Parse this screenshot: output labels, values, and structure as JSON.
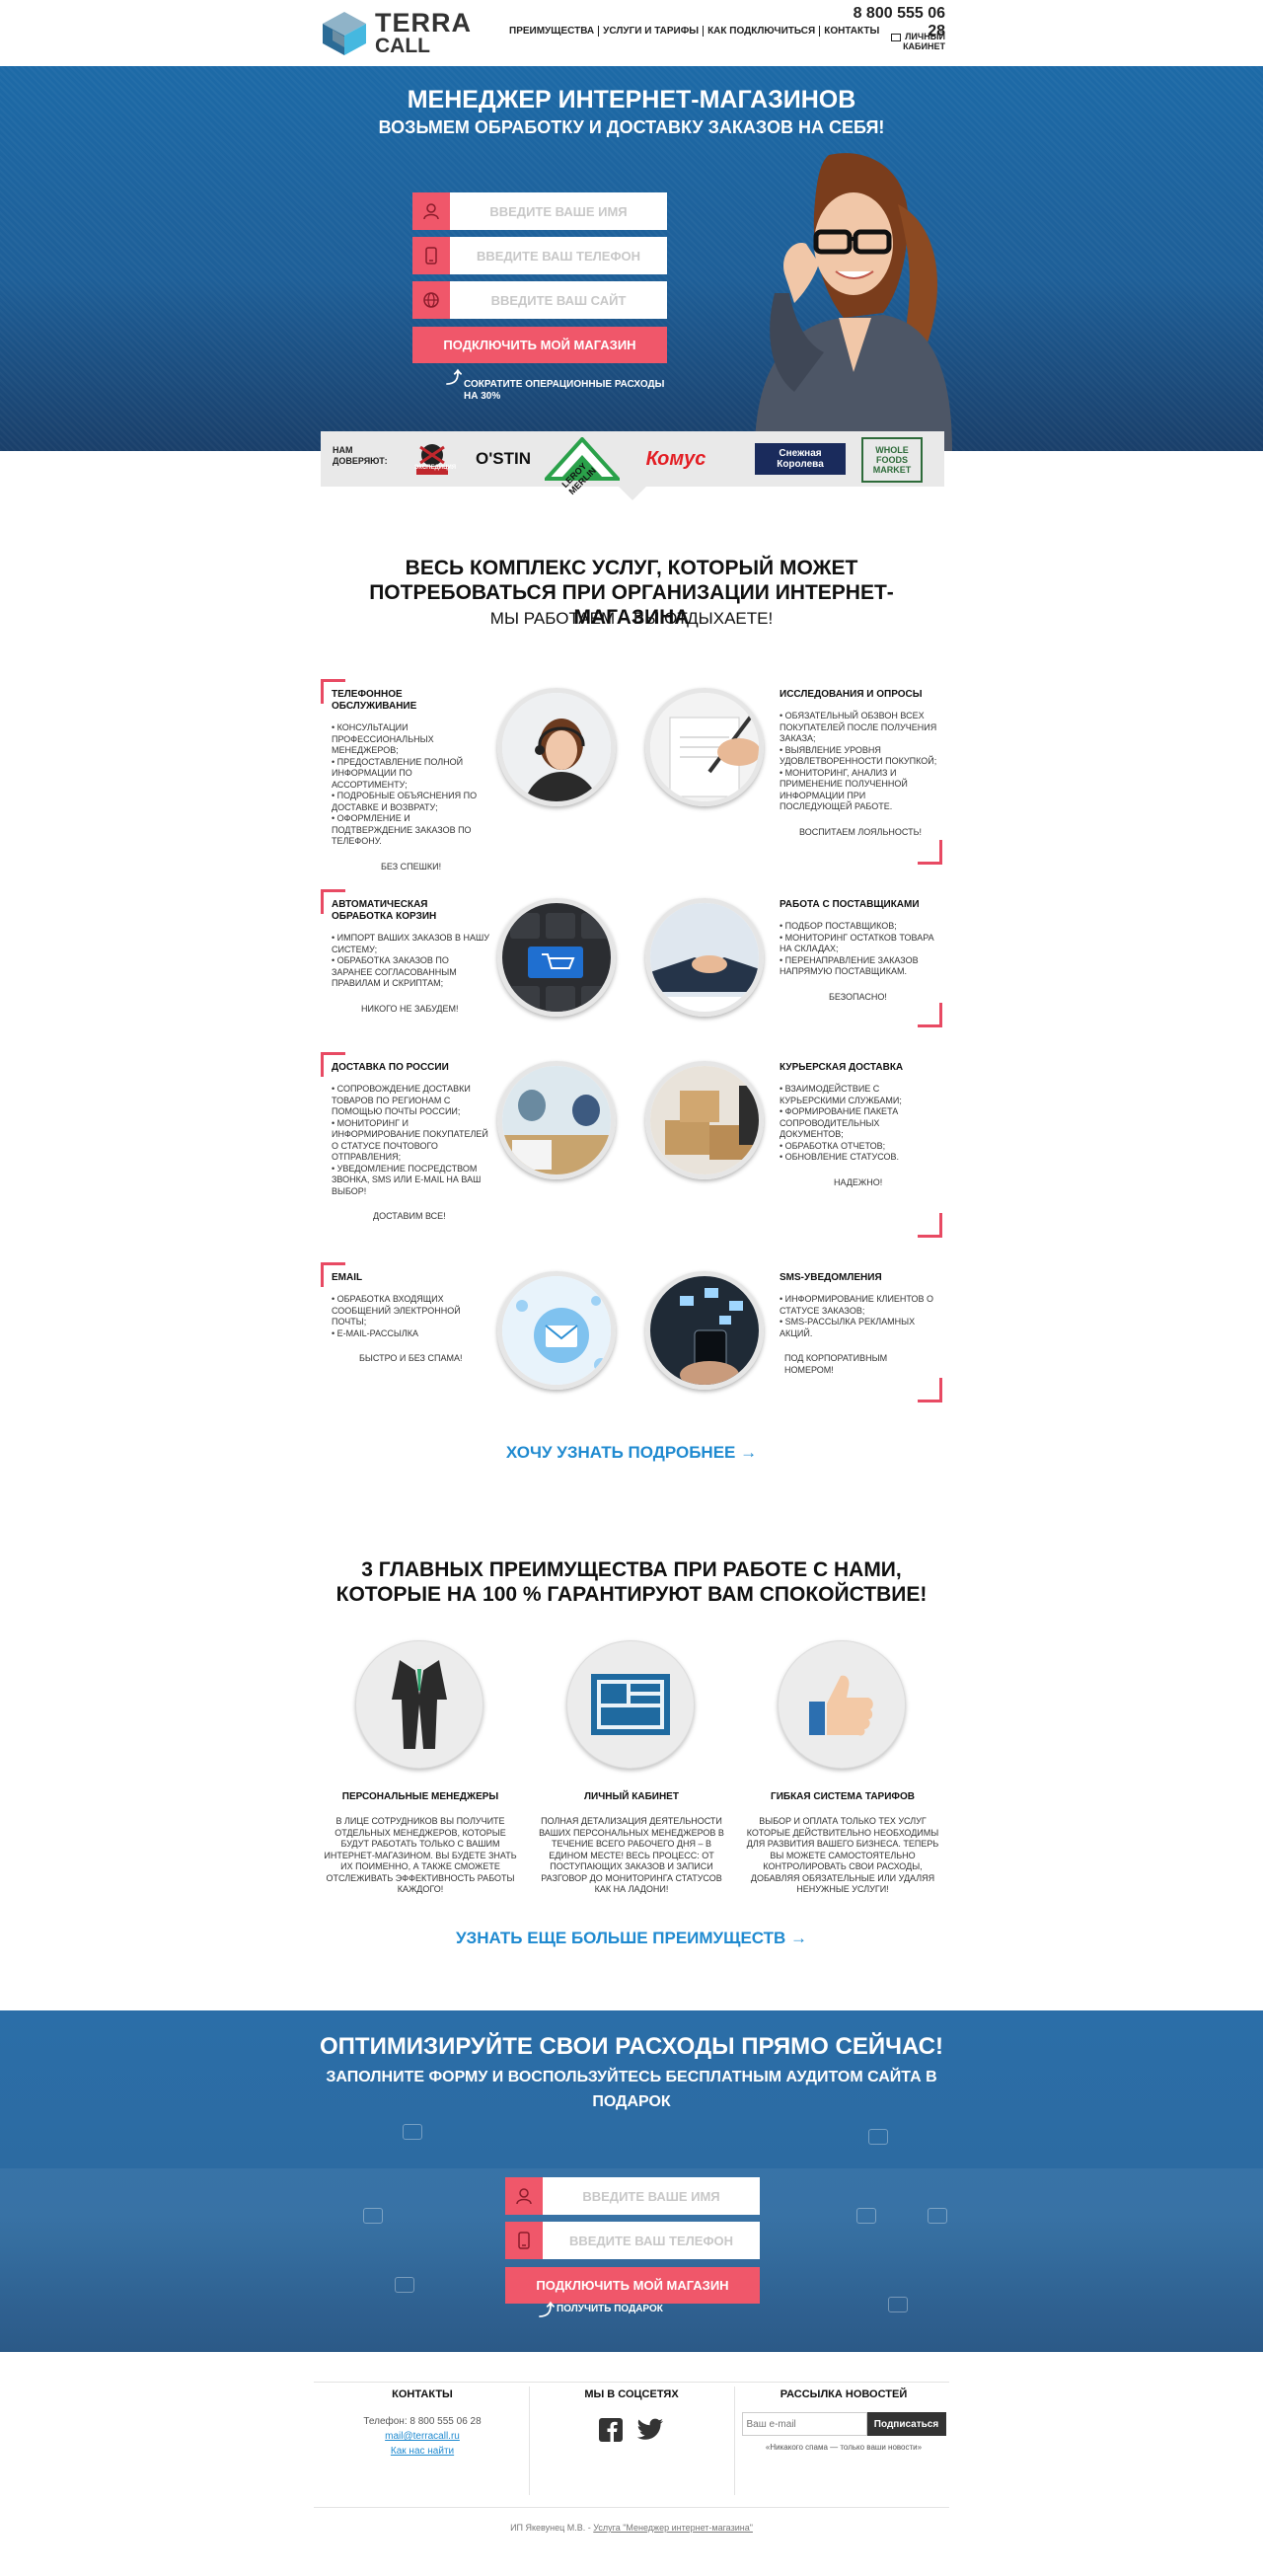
{
  "header": {
    "logo_text1": "TERRA",
    "logo_text2": "CALL",
    "nav": [
      "ПРЕИМУЩЕСТВА",
      "УСЛУГИ И ТАРИФЫ",
      "КАК ПОДКЛЮЧИТЬСЯ",
      "КОНТАКТЫ"
    ],
    "phone": "8 800 555 06 28",
    "cabinet": "ЛИЧНЫЙ КАБИНЕТ"
  },
  "hero": {
    "title": "МЕНЕДЖЕР ИНТЕРНЕТ-МАГАЗИНОВ",
    "subtitle": "ВОЗЬМЕМ ОБРАБОТКУ И ДОСТАВКУ ЗАКАЗОВ НА СЕБЯ!",
    "name_placeholder": "ВВЕДИТЕ ВАШЕ ИМЯ",
    "phone_placeholder": "ВВЕДИТЕ ВАШ ТЕЛЕФОН",
    "site_placeholder": "ВВЕДИТЕ ВАШ САЙТ",
    "submit": "ПОДКЛЮЧИТЬ МОЙ МАГАЗИН",
    "note": "СОКРАТИТЕ ОПЕРАЦИОННЫЕ РАСХОДЫ НА 30%"
  },
  "clients": {
    "label": "НАМ ДОВЕРЯЮТ:",
    "brands": [
      "ЭКСПЕДИЦИЯ",
      "O'STIN",
      "LEROY MERLIN",
      "Комус",
      "Снежная Королева",
      "WHOLE FOODS MARKET"
    ]
  },
  "services": {
    "title": "ВЕСЬ КОМПЛЕКС УСЛУГ, КОТОРЫЙ МОЖЕТ ПОТРЕБОВАТЬСЯ ПРИ ОРГАНИЗАЦИИ ИНТЕРНЕТ-МАГАЗИНА",
    "subtitle": "МЫ РАБОТАЕМ – ВЫ ОТДЫХАЕТЕ!",
    "items": [
      {
        "title": "ТЕЛЕФОННОЕ ОБСЛУЖИВАНИЕ",
        "body": "• КОНСУЛЬТАЦИИ ПРОФЕССИОНАЛЬНЫХ МЕНЕДЖЕРОВ;\n• ПРЕДОСТАВЛЕНИЕ ПОЛНОЙ ИНФОРМАЦИИ ПО АССОРТИМЕНТУ;\n• ПОДРОБНЫЕ ОБЪЯСНЕНИЯ ПО ДОСТАВКЕ И ВОЗВРАТУ;\n• ОФОРМЛЕНИЕ И ПОДТВЕРЖДЕНИЕ ЗАКАЗОВ ПО ТЕЛЕФОНУ.",
        "tag": "БЕЗ СПЕШКИ!"
      },
      {
        "title": "ИССЛЕДОВАНИЯ И ОПРОСЫ",
        "body": "• ОБЯЗАТЕЛЬНЫЙ ОБЗВОН ВСЕХ ПОКУПАТЕЛЕЙ ПОСЛЕ ПОЛУЧЕНИЯ ЗАКАЗА;\n• ВЫЯВЛЕНИЕ УРОВНЯ УДОВЛЕТВОРЕННОСТИ ПОКУПКОЙ;\n• МОНИТОРИНГ, АНАЛИЗ И ПРИМЕНЕНИЕ ПОЛУЧЕННОЙ ИНФОРМАЦИИ ПРИ ПОСЛЕДУЮЩЕЙ РАБОТЕ.",
        "tag": "ВОСПИТАЕМ ЛОЯЛЬНОСТЬ!"
      },
      {
        "title": "АВТОМАТИЧЕСКАЯ ОБРАБОТКА КОРЗИН",
        "body": "• ИМПОРТ ВАШИХ ЗАКАЗОВ В НАШУ СИСТЕМУ;\n• ОБРАБОТКА ЗАКАЗОВ ПО ЗАРАНЕЕ СОГЛАСОВАННЫМ ПРАВИЛАМ И СКРИПТАМ;",
        "tag": "НИКОГО НЕ ЗАБУДЕМ!"
      },
      {
        "title": "РАБОТА С ПОСТАВЩИКАМИ",
        "body": "• ПОДБОР ПОСТАВЩИКОВ;\n• МОНИТОРИНГ ОСТАТКОВ ТОВАРА НА СКЛАДАХ;\n• ПЕРЕНАПРАВЛЕНИЕ ЗАКАЗОВ НАПРЯМУЮ ПОСТАВЩИКАМ.",
        "tag": "БЕЗОПАСНО!"
      },
      {
        "title": "ДОСТАВКА ПО РОССИИ",
        "body": "• СОПРОВОЖДЕНИЕ ДОСТАВКИ ТОВАРОВ ПО РЕГИОНАМ С ПОМОЩЬЮ ПОЧТЫ РОССИИ;\n• МОНИТОРИНГ И ИНФОРМИРОВАНИЕ ПОКУПАТЕЛЕЙ О СТАТУСЕ ПОЧТОВОГО ОТПРАВЛЕНИЯ;\n• УВЕДОМЛЕНИЕ ПОСРЕДСТВОМ ЗВОНКА, SMS ИЛИ E-MAIL НА ВАШ ВЫБОР!",
        "tag": "ДОСТАВИМ ВСЕ!"
      },
      {
        "title": "КУРЬЕРСКАЯ ДОСТАВКА",
        "body": "• ВЗАИМОДЕЙСТВИЕ С КУРЬЕРСКИМИ СЛУЖБАМИ;\n• ФОРМИРОВАНИЕ ПАКЕТА СОПРОВОДИТЕЛЬНЫХ ДОКУМЕНТОВ;\n• ОБРАБОТКА ОТЧЕТОВ;\n• ОБНОВЛЕНИЕ СТАТУСОВ.",
        "tag": "НАДЕЖНО!"
      },
      {
        "title": "EMAIL",
        "body": "• ОБРАБОТКА ВХОДЯЩИХ СООБЩЕНИЙ ЭЛЕКТРОННОЙ ПОЧТЫ;\n• E-MAIL-РАССЫЛКА",
        "tag": "БЫСТРО И БЕЗ СПАМА!"
      },
      {
        "title": "SMS-УВЕДОМЛЕНИЯ",
        "body": "• ИНФОРМИРОВАНИЕ КЛИЕНТОВ О СТАТУСЕ ЗАКАЗОВ;\n• SMS-РАССЫЛКА РЕКЛАМНЫХ АКЦИЙ.",
        "tag": "ПОД КОРПОРАТИВНЫМ НОМЕРОМ!"
      }
    ],
    "more_link": "ХОЧУ УЗНАТЬ ПОДРОБНЕЕ →"
  },
  "advantages": {
    "title": "3 ГЛАВНЫХ ПРЕИМУЩЕСТВА ПРИ РАБОТЕ С НАМИ, КОТОРЫЕ НА 100 % ГАРАНТИРУЮТ ВАМ СПОКОЙСТВИЕ!",
    "items": [
      {
        "title": "ПЕРСОНАЛЬНЫЕ МЕНЕДЖЕРЫ",
        "text": "В ЛИЦЕ СОТРУДНИКОВ ВЫ ПОЛУЧИТЕ ОТДЕЛЬНЫХ МЕНЕДЖЕРОВ, КОТОРЫЕ БУДУТ РАБОТАТЬ ТОЛЬКО С ВАШИМ ИНТЕРНЕТ-МАГАЗИНОМ. ВЫ БУДЕТЕ ЗНАТЬ ИХ ПОИМЕННО, А ТАКЖЕ СМОЖЕТЕ ОТСЛЕЖИВАТЬ ЭФФЕКТИВНОСТЬ РАБОТЫ КАЖДОГО!"
      },
      {
        "title": "ЛИЧНЫЙ КАБИНЕТ",
        "text": "ПОЛНАЯ ДЕТАЛИЗАЦИЯ ДЕЯТЕЛЬНОСТИ ВАШИХ ПЕРСОНАЛЬНЫХ МЕНЕДЖЕРОВ В ТЕЧЕНИЕ ВСЕГО РАБОЧЕГО ДНЯ – В ЕДИНОМ МЕСТЕ! ВЕСЬ ПРОЦЕСС: ОТ ПОСТУПАЮЩИХ ЗАКАЗОВ И ЗАПИСИ РАЗГОВОР ДО МОНИТОРИНГА СТАТУСОВ КАК НА ЛАДОНИ!"
      },
      {
        "title": "ГИБКАЯ СИСТЕМА ТАРИФОВ",
        "text": "ВЫБОР И ОПЛАТА ТОЛЬКО ТЕХ УСЛУГ КОТОРЫЕ ДЕЙСТВИТЕЛЬНО НЕОБХОДИМЫ ДЛЯ РАЗВИТИЯ ВАШЕГО БИЗНЕСА. ТЕПЕРЬ ВЫ МОЖЕТЕ САМОСТОЯТЕЛЬНО КОНТРОЛИРОВАТЬ СВОИ РАСХОДЫ, ДОБАВЛЯЯ ОБЯЗАТЕЛЬНЫЕ ИЛИ УДАЛЯЯ НЕНУЖНЫЕ УСЛУГИ!"
      }
    ],
    "more_link": "УЗНАТЬ ЕЩЕ БОЛЬШЕ ПРЕИМУЩЕСТВ →"
  },
  "cta": {
    "title": "ОПТИМИЗИРУЙТЕ СВОИ РАСХОДЫ ПРЯМО СЕЙЧАС!",
    "subtitle": "ЗАПОЛНИТЕ ФОРМУ И ВОСПОЛЬЗУЙТЕСЬ БЕСПЛАТНЫМ АУДИТОМ САЙТА В ПОДАРОК",
    "name_placeholder": "ВВЕДИТЕ ВАШЕ ИМЯ",
    "phone_placeholder": "ВВЕДИТЕ ВАШ ТЕЛЕФОН",
    "submit": "ПОДКЛЮЧИТЬ МОЙ МАГАЗИН",
    "note": "ПОЛУЧИТЬ ПОДАРОК"
  },
  "footer": {
    "contacts_title": "КОНТАКТЫ",
    "phone": "Телефон: 8 800 555 06 28",
    "email": "mail@terracall.ru",
    "how_to_find": "Как нас найти",
    "social_title": "МЫ В СОЦСЕТЯХ",
    "news_title": "РАССЫЛКА НОВОСТЕЙ",
    "news_placeholder": "Ваш e-mail",
    "news_button": "Подписаться",
    "news_note": "«Никакого спама — только ваши новости»",
    "copyright_prefix": "ИП Якевунец М.В. - ",
    "copyright_link": "Услуга \"Менеджер интернет-магазина\""
  },
  "colors": {
    "accent": "#f0576a",
    "corner": "#e84a63",
    "link": "#1f8ad0",
    "hero_blue": "#1e5f98"
  }
}
